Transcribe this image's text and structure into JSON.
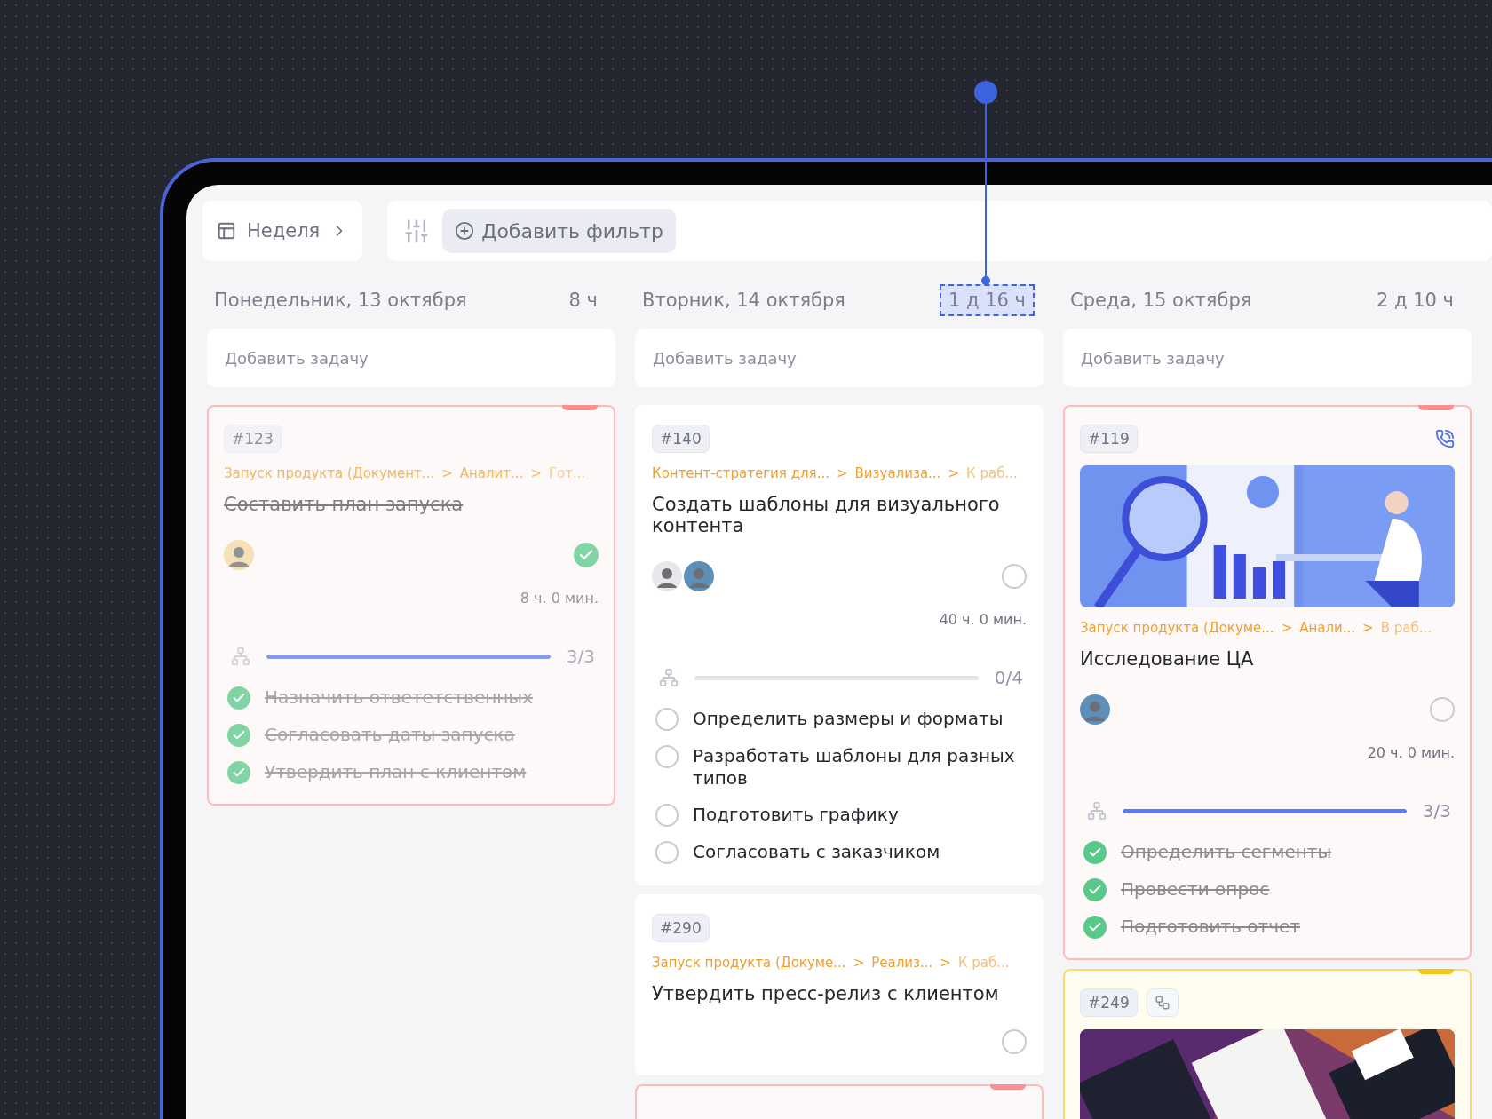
{
  "toolbar": {
    "view": "Неделя",
    "filter_button": "Добавить фильтр"
  },
  "columns": [
    {
      "title": "Понедельник, 13 октября",
      "total": "8 ч",
      "highlighted": false,
      "add_placeholder": "Добавить задачу",
      "cards": [
        {
          "id": "#123",
          "color": "#ff8f8f",
          "done": true,
          "breadcrumb": [
            "Запуск продукта (Документ...",
            ">",
            "Аналит...",
            ">",
            "Гот..."
          ],
          "title": "Составить план запуска",
          "time": "8 ч. 0 мин.",
          "subtasks": {
            "count": "3/3",
            "level": 1,
            "items": [
              {
                "text": "Назначить ответетственных",
                "checked": true
              },
              {
                "text": "Согласовать даты запуска",
                "checked": true
              },
              {
                "text": "Утвердить план с клиентом",
                "checked": true
              }
            ]
          }
        }
      ]
    },
    {
      "title": "Вторник, 14 октября",
      "total": "1 д 16 ч",
      "highlighted": true,
      "add_placeholder": "Добавить задачу",
      "cards": [
        {
          "id": "#140",
          "done": false,
          "breadcrumb": [
            "Контент-стратегия для...",
            ">",
            "Визуализа...",
            ">",
            "К раб..."
          ],
          "title": "Создать шаблоны для визуального контента",
          "time": "40 ч. 0 мин.",
          "subtasks": {
            "count": "0/4",
            "level": 0,
            "items": [
              {
                "text": "Определить размеры и форматы",
                "checked": false
              },
              {
                "text": "Разработать шаблоны для разных типов",
                "checked": false
              },
              {
                "text": "Подготовить графику",
                "checked": false
              },
              {
                "text": "Согласовать с заказчиком",
                "checked": false
              }
            ]
          }
        },
        {
          "id": "#290",
          "done": false,
          "breadcrumb": [
            "Запуск продукта (Докуме...",
            ">",
            "Реализ...",
            ">",
            "К раб..."
          ],
          "title": "Утвердить пресс-релиз с клиентом"
        },
        {
          "color": "#ff8f8f"
        }
      ]
    },
    {
      "title": "Среда, 15 октября",
      "total": "2 д 10 ч",
      "highlighted": false,
      "add_placeholder": "Добавить задачу",
      "cards": [
        {
          "id": "#119",
          "color": "#ff8f8f",
          "badge": {
            "kind": "phone"
          },
          "done": false,
          "breadcrumb": [
            "Запуск продукта (Докуме...",
            ">",
            "Анали...",
            ">",
            "В раб..."
          ],
          "title": "Исследование ЦА",
          "time": "20 ч. 0 мин.",
          "subtasks": {
            "count": "3/3",
            "level": 1,
            "items": [
              {
                "text": "Определить сегменты",
                "checked": true
              },
              {
                "text": "Провести опрос",
                "checked": true
              },
              {
                "text": "Подготовить отчет",
                "checked": true
              }
            ]
          }
        },
        {
          "id": "#249",
          "color": "#f5c518",
          "badge": {
            "kind": "link"
          }
        }
      ]
    }
  ]
}
